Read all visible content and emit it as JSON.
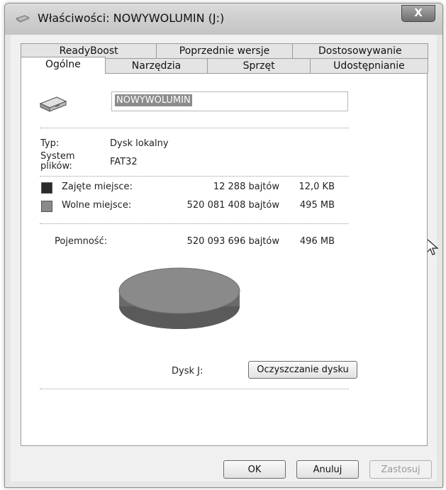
{
  "window": {
    "title": "Właściwości: NOWYWOLUMIN (J:)",
    "close_label": "X"
  },
  "tabs": {
    "row1": [
      "ReadyBoost",
      "Poprzednie wersje",
      "Dostosowywanie"
    ],
    "row2": [
      "Ogólne",
      "Narzędzia",
      "Sprzęt",
      "Udostępnianie"
    ],
    "active": "Ogólne"
  },
  "general": {
    "volume_name": "NOWYWOLUMIN",
    "type_label": "Typ:",
    "type_value": "Dysk lokalny",
    "fs_label": "System plików:",
    "fs_value": "FAT32",
    "used_label": "Zajęte miejsce:",
    "used_bytes": "12 288 bajtów",
    "used_size": "12,0 KB",
    "free_label": "Wolne miejsce:",
    "free_bytes": "520 081 408 bajtów",
    "free_size": "495 MB",
    "capacity_label": "Pojemność:",
    "capacity_bytes": "520 093 696 bajtów",
    "capacity_size": "496 MB",
    "drive_label": "Dysk J:",
    "cleanup_button": "Oczyszczanie dysku"
  },
  "colors": {
    "used_color": "#2b2b2b",
    "free_color": "#8a8a8a"
  },
  "buttons": {
    "ok": "OK",
    "cancel": "Anuluj",
    "apply": "Zastosuj"
  },
  "icons": {
    "title": "drive-icon",
    "drive": "usb-drive-icon",
    "cursor": "mouse-pointer-icon"
  }
}
